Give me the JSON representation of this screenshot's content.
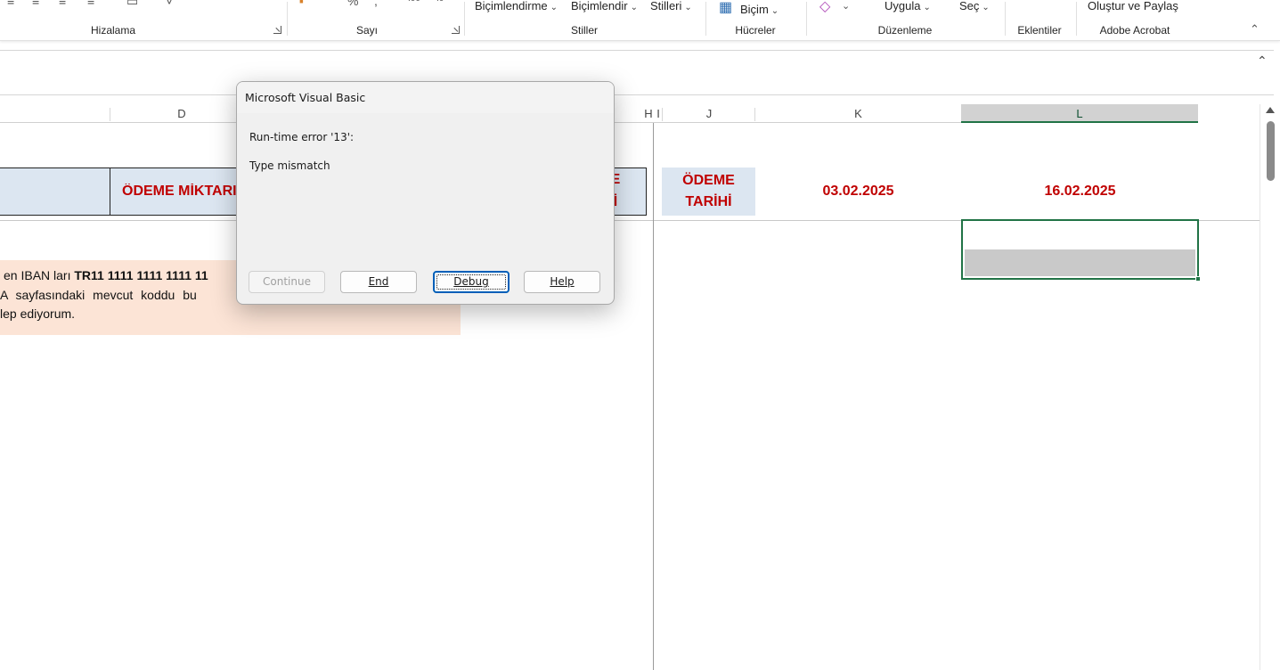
{
  "ribbon": {
    "buttons": {
      "kosullu_bicimlendirme": "Biçimlendirme",
      "tablo_bicimlendir": "Biçimlendir",
      "hucre_stilleri": "Stilleri",
      "bicim": "Biçim",
      "uygula": "Uygula",
      "sec": "Seç",
      "olustur_paylas": "Oluştur ve Paylaş"
    },
    "groups": {
      "hizalama": "Hizalama",
      "sayi": "Sayı",
      "stiller": "Stiller",
      "hucreler": "Hücreler",
      "duzenleme": "Düzenleme",
      "eklentiler": "Eklentiler",
      "adobe": "Adobe Acrobat"
    }
  },
  "columns": {
    "D": "D",
    "H": "H",
    "I": "I",
    "J": "J",
    "K": "K",
    "L": "L",
    "selected": "L"
  },
  "sheet": {
    "odeme_miktari": "ÖDEME MİKTARI",
    "right_header_partial_top": "E",
    "right_header_partial_bottom": "İ",
    "odeme_tarihi_line1": "ÖDEME",
    "odeme_tarihi_line2": "TARİHİ",
    "date_k": "03.02.2025",
    "date_l": "16.02.2025",
    "note": {
      "line1_prefix": "en IBAN ları ",
      "line1_bold": "TR11 1111 1111 1111 11",
      "line2": "A sayfasındaki mevcut koddu bu",
      "line3": "lep ediyorum."
    }
  },
  "dialog": {
    "title": "Microsoft Visual Basic",
    "error": "Run-time error '13':",
    "message": "Type mismatch",
    "buttons": {
      "continue": "Continue",
      "end": "End",
      "debug": "Debug",
      "help": "Help"
    }
  },
  "colors": {
    "header_red": "#c00000",
    "header_fill": "#dce6f1",
    "note_fill": "#fce4d6",
    "selection_green": "#217346",
    "default_button_blue": "#005fb8"
  }
}
